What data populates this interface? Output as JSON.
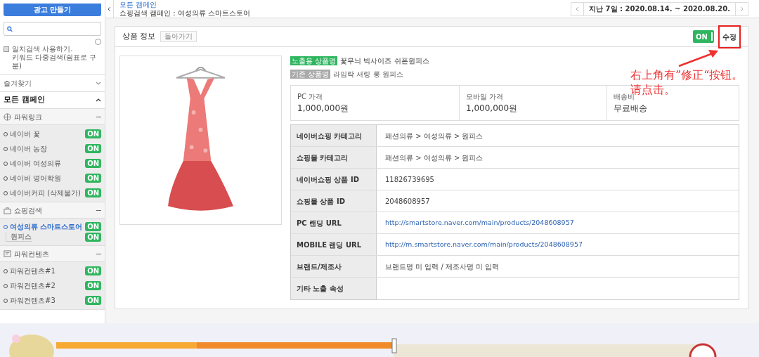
{
  "sidebar": {
    "create_button": "광고 만들기",
    "match_search": {
      "checked": false,
      "label": "일치검색 사용하기.",
      "sublabel": "키워드 다중검색(쉼표로 구분)"
    },
    "sections": [
      {
        "label": "즐겨찾기",
        "expanded": false
      },
      {
        "label": "모든 캠페인",
        "expanded": true
      }
    ],
    "groups": [
      {
        "kind": "powerlink",
        "label": "파워링크",
        "expanded": true,
        "items": [
          {
            "label": "네이버 꽃",
            "status": "ON",
            "selected": false
          },
          {
            "label": "네이버 농장",
            "status": "ON",
            "selected": false
          },
          {
            "label": "네이버 여성의류",
            "status": "ON",
            "selected": false
          },
          {
            "label": "네이버 영어학원",
            "status": "ON",
            "selected": false
          },
          {
            "label": "네이버커피 (삭제불가)",
            "status": "ON",
            "selected": false
          }
        ]
      },
      {
        "kind": "shopping",
        "label": "쇼핑검색",
        "expanded": true,
        "items": [
          {
            "label": "여성의류 스마트스토어",
            "status": "ON",
            "selected": true,
            "children": [
              {
                "label": "원피스",
                "status": "ON",
                "selected": false
              }
            ]
          }
        ]
      },
      {
        "kind": "content",
        "label": "파워컨텐츠",
        "expanded": true,
        "items": [
          {
            "label": "파워컨텐츠#1",
            "status": "ON",
            "selected": false
          },
          {
            "label": "파워컨텐츠#2",
            "status": "ON",
            "selected": false
          },
          {
            "label": "파워컨텐츠#3",
            "status": "ON",
            "selected": false
          }
        ]
      }
    ]
  },
  "header": {
    "breadcrumb": "모든 캠페인",
    "title": "쇼핑검색 캠페인 : 여성의류 스마트스토어",
    "date_range": "지난 7일 : 2020.08.14. ~ 2020.08.20."
  },
  "product": {
    "title": "상품 정보",
    "back_button": "돌아가기",
    "toggle": {
      "label": "ON",
      "on": true
    },
    "edit_button": "수정",
    "exposed_name_tag": "노출용 상품명",
    "exposed_name": "꽃무늬 빅사이즈 쉬폰원피스",
    "original_name_tag": "기존 상품명",
    "original_name": "라임락 셔링 롱 원피스",
    "prices": [
      {
        "label": "PC 가격",
        "value": "1,000,000원"
      },
      {
        "label": "모바일 가격",
        "value": "1,000,000원"
      },
      {
        "label": "배송비",
        "value": "무료배송"
      }
    ],
    "details": [
      {
        "label": "네이버쇼핑 카테고리",
        "value": "패션의류 > 여성의류 > 원피스",
        "kind": "text"
      },
      {
        "label": "쇼핑몰 카테고리",
        "value": "패션의류 > 여성의류 > 원피스",
        "kind": "text"
      },
      {
        "label": "네이버쇼핑 상품 ID",
        "value": "11826739695",
        "kind": "text"
      },
      {
        "label": "쇼핑몰 상품 ID",
        "value": "2048608957",
        "kind": "text"
      },
      {
        "label": "PC 랜딩 URL",
        "value": "http://smartstore.naver.com/main/products/2048608957",
        "kind": "link"
      },
      {
        "label": "MOBILE 랜딩 URL",
        "value": "http://m.smartstore.naver.com/main/products/2048608957",
        "kind": "link"
      },
      {
        "label": "브랜드/제조사",
        "value": "브랜드명 미 입력 / 제조사명 미 입력",
        "kind": "text"
      },
      {
        "label": "기타 노출 속성",
        "kind": "empty"
      }
    ]
  },
  "annotation": {
    "text": "右上角有”修正“按钮。请点击。"
  }
}
